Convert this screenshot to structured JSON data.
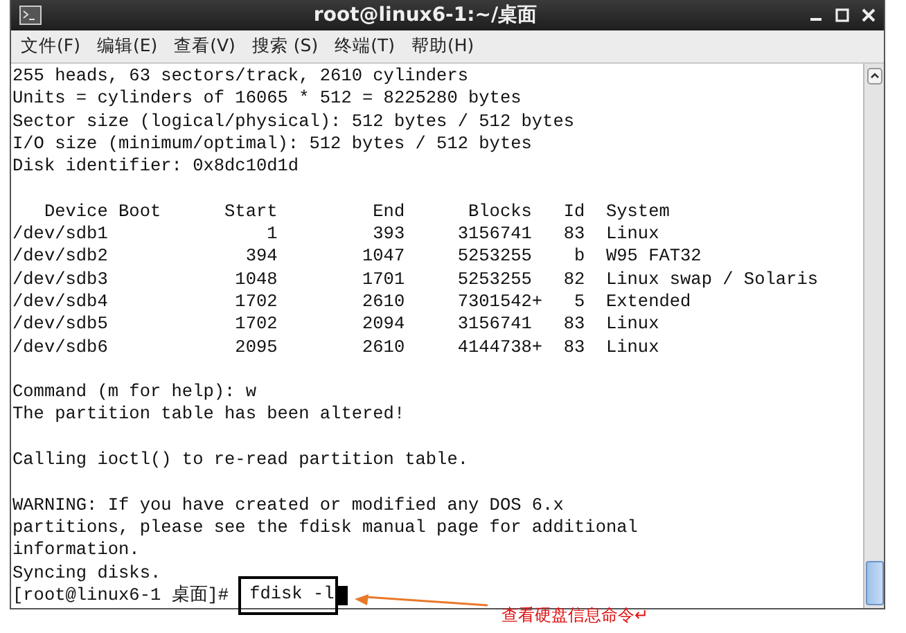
{
  "window": {
    "title": "root@linux6-1:~/桌面"
  },
  "menu": [
    "文件(F)",
    "编辑(E)",
    "查看(V)",
    "搜索 (S)",
    "终端(T)",
    "帮助(H)"
  ],
  "terminal": {
    "blocks": [
      [
        "255 heads, 63 sectors/track, 2610 cylinders",
        "Units = cylinders of 16065 * 512 = 8225280 bytes",
        "Sector size (logical/physical): 512 bytes / 512 bytes",
        "I/O size (minimum/optimal): 512 bytes / 512 bytes",
        "Disk identifier: 0x8dc10d1d"
      ],
      [
        "   Device Boot      Start         End      Blocks   Id  System",
        "/dev/sdb1               1         393     3156741   83  Linux",
        "/dev/sdb2             394        1047     5253255    b  W95 FAT32",
        "/dev/sdb3            1048        1701     5253255   82  Linux swap / Solaris",
        "/dev/sdb4            1702        2610     7301542+   5  Extended",
        "/dev/sdb5            1702        2094     3156741   83  Linux",
        "/dev/sdb6            2095        2610     4144738+  83  Linux"
      ],
      [
        "Command (m for help): w",
        "The partition table has been altered!"
      ],
      [
        "Calling ioctl() to re-read partition table."
      ],
      [
        "WARNING: If you have created or modified any DOS 6.x",
        "partitions, please see the fdisk manual page for additional",
        "information.",
        "Syncing disks."
      ]
    ],
    "prompt": "[root@linux6-1 桌面]#",
    "command": "fdisk -l"
  },
  "annotation": {
    "text": "查看硬盘信息命令↵"
  }
}
